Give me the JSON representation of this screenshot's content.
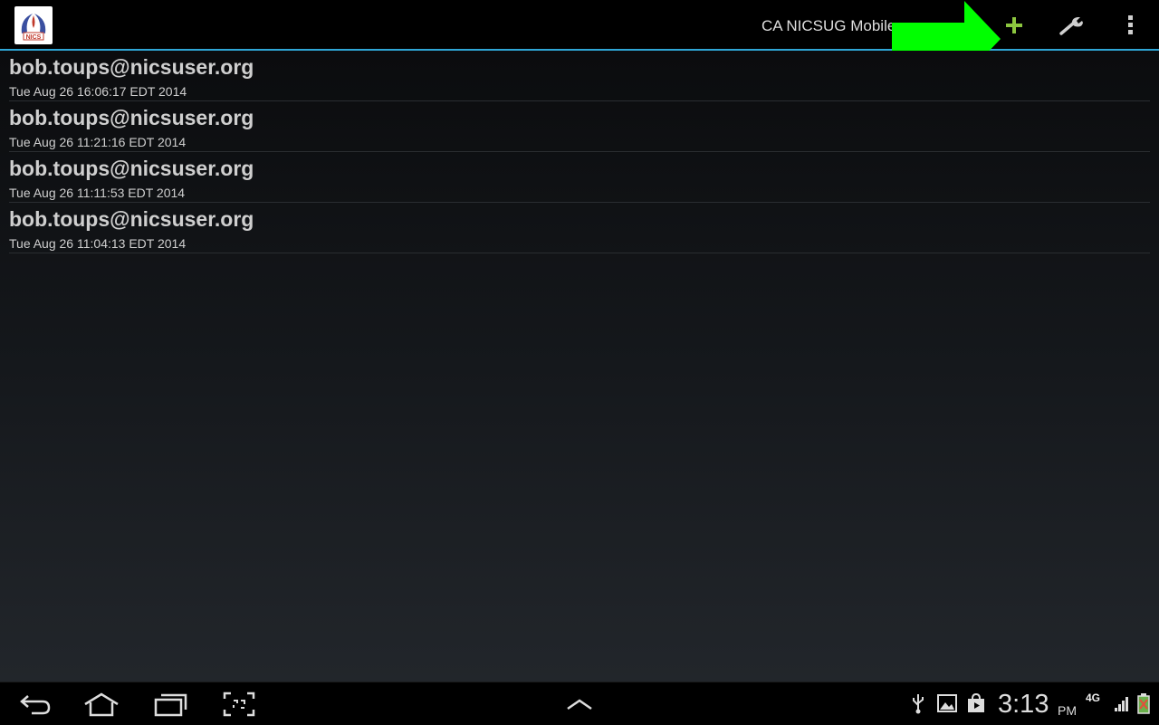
{
  "action_bar": {
    "title": "CA NICSUG Mobile",
    "logo_text": "NICS",
    "actions": [
      {
        "name": "add",
        "icon": "plus-icon",
        "color": "#8cc63f"
      },
      {
        "name": "settings",
        "icon": "wrench-icon"
      },
      {
        "name": "overflow",
        "icon": "overflow-menu-icon"
      }
    ],
    "callout_color": "#00ff00",
    "accent_color": "#2fa6d6"
  },
  "reports": [
    {
      "email": "bob.toups@nicsuser.org",
      "date": "Tue Aug 26 16:06:17 EDT 2014"
    },
    {
      "email": "bob.toups@nicsuser.org",
      "date": "Tue Aug 26 11:21:16 EDT 2014"
    },
    {
      "email": "bob.toups@nicsuser.org",
      "date": "Tue Aug 26 11:11:53 EDT 2014"
    },
    {
      "email": "bob.toups@nicsuser.org",
      "date": "Tue Aug 26 11:04:13 EDT 2014"
    }
  ],
  "system_bar": {
    "nav_icons": [
      "back-icon",
      "home-icon",
      "recent-apps-icon",
      "screenshot-icon",
      "up-chevron-icon"
    ],
    "status_icons": [
      "usb-icon",
      "gallery-icon",
      "store-icon",
      "signal-icon",
      "battery-icon"
    ],
    "time": "3:13",
    "ampm": "PM",
    "network": "4G"
  }
}
